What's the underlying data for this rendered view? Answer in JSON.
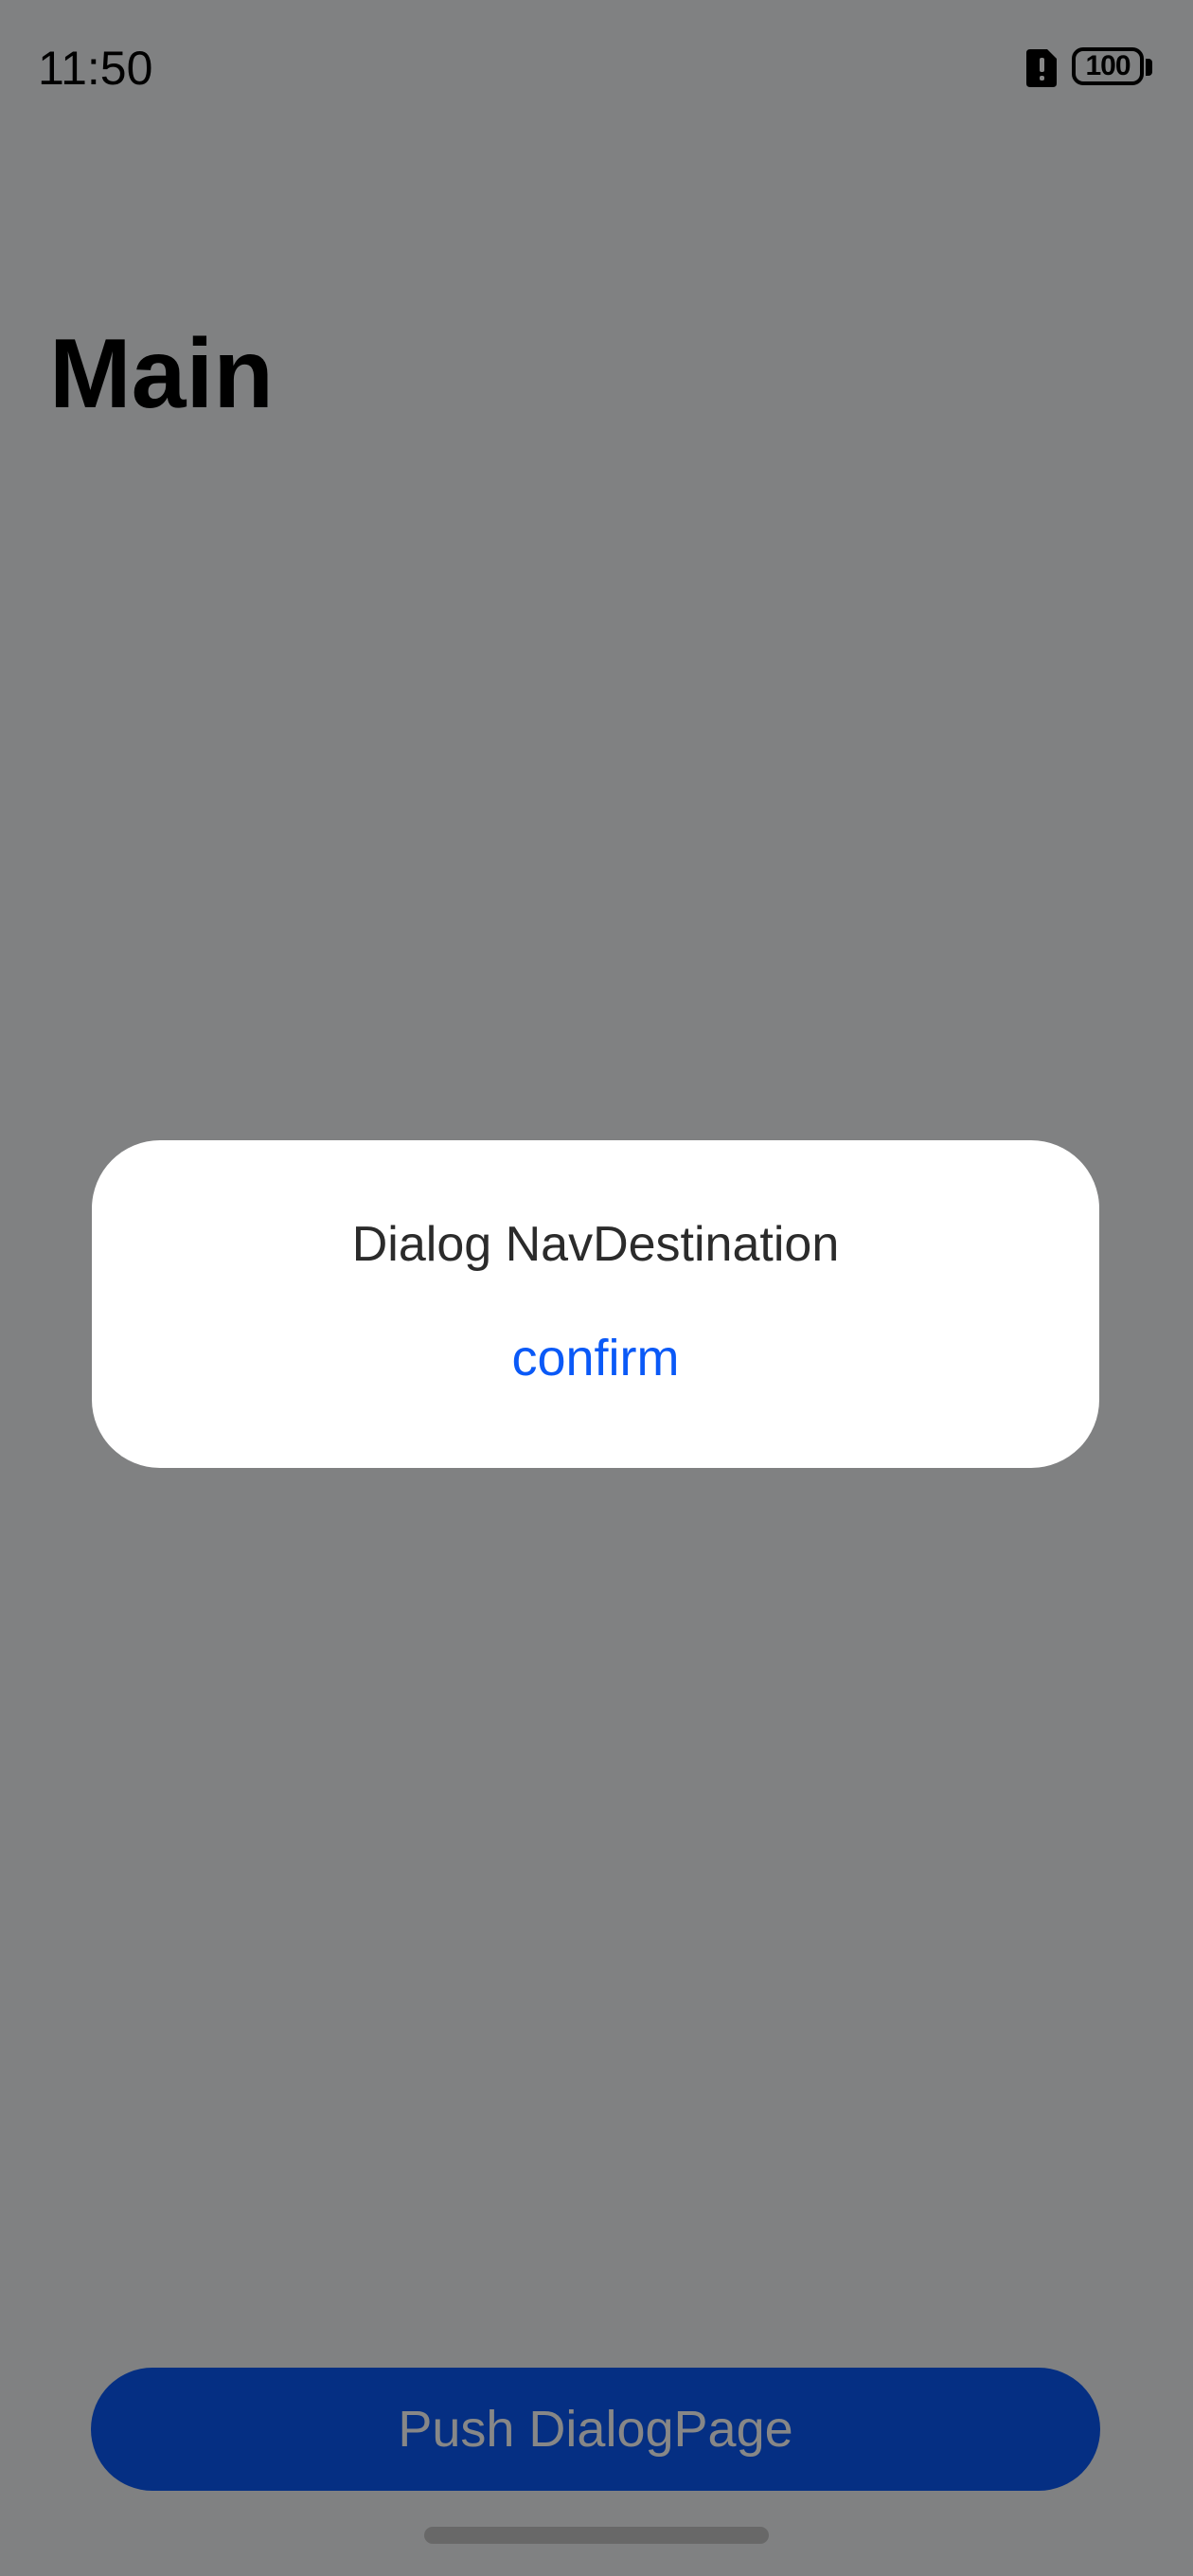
{
  "status_bar": {
    "time": "11:50",
    "battery_level": "100",
    "sim_icon": "sim-alert-icon",
    "battery_icon": "battery-icon"
  },
  "page": {
    "title": "Main"
  },
  "bottom_button": {
    "label": "Push DialogPage"
  },
  "dialog": {
    "message": "Dialog NavDestination",
    "confirm_label": "confirm"
  },
  "colors": {
    "accent": "#0a59f7",
    "background": "#f1f3f5",
    "mask": "rgba(0,0,0,0.47)",
    "dialog_bg": "#ffffff"
  }
}
